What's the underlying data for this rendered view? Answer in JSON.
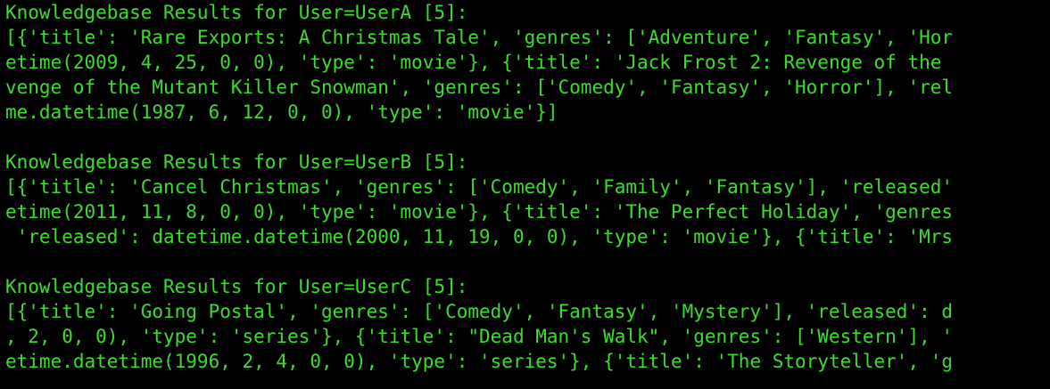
{
  "terminal": {
    "text_color": "#3ddc2f",
    "background": "#000000",
    "lines": [
      "Knowledgebase Results for User=UserA [5]:",
      "[{'title': 'Rare Exports: A Christmas Tale', 'genres': ['Adventure', 'Fantasy', 'Hor",
      "etime(2009, 4, 25, 0, 0), 'type': 'movie'}, {'title': 'Jack Frost 2: Revenge of the",
      "venge of the Mutant Killer Snowman', 'genres': ['Comedy', 'Fantasy', 'Horror'], 'rel",
      "me.datetime(1987, 6, 12, 0, 0), 'type': 'movie'}]",
      "",
      "Knowledgebase Results for User=UserB [5]:",
      "[{'title': 'Cancel Christmas', 'genres': ['Comedy', 'Family', 'Fantasy'], 'released'",
      "etime(2011, 11, 8, 0, 0), 'type': 'movie'}, {'title': 'The Perfect Holiday', 'genres",
      " 'released': datetime.datetime(2000, 11, 19, 0, 0), 'type': 'movie'}, {'title': 'Mrs",
      "",
      "Knowledgebase Results for User=UserC [5]:",
      "[{'title': 'Going Postal', 'genres': ['Comedy', 'Fantasy', 'Mystery'], 'released': d",
      ", 2, 0, 0), 'type': 'series'}, {'title': \"Dead Man's Walk\", 'genres': ['Western'], '",
      "etime.datetime(1996, 2, 4, 0, 0), 'type': 'series'}, {'title': 'The Storyteller', 'g"
    ]
  }
}
